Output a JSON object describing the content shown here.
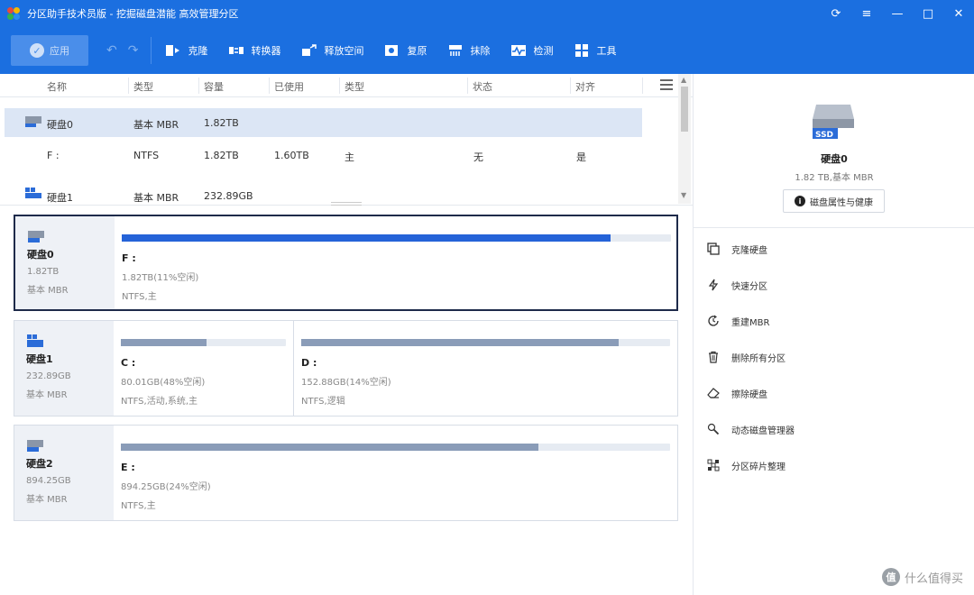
{
  "titlebar": {
    "title": "分区助手技术员版 - 挖掘磁盘潜能 高效管理分区",
    "controls": [
      "⟳",
      "≡",
      "—",
      "□",
      "✕"
    ]
  },
  "toolbar": {
    "apply_label": "应用",
    "tools": [
      {
        "label": "克隆",
        "icon": "clone-icon"
      },
      {
        "label": "转换器",
        "icon": "convert-icon"
      },
      {
        "label": "释放空间",
        "icon": "free-space-icon"
      },
      {
        "label": "复原",
        "icon": "recover-icon"
      },
      {
        "label": "抹除",
        "icon": "wipe-icon"
      },
      {
        "label": "检测",
        "icon": "test-icon"
      },
      {
        "label": "工具",
        "icon": "tools-icon"
      }
    ]
  },
  "table": {
    "headers": [
      "名称",
      "类型",
      "容量",
      "已使用",
      "类型",
      "状态",
      "对齐"
    ],
    "rows": [
      {
        "name": "硬盘0",
        "type": "基本 MBR",
        "capacity": "1.82TB",
        "used": "",
        "fs": "",
        "status": "",
        "align": ""
      },
      {
        "name": "F :",
        "type": "NTFS",
        "capacity": "1.82TB",
        "used": "1.60TB",
        "fs": "主",
        "status": "无",
        "align": "是"
      },
      {
        "name": "硬盘1",
        "type": "基本 MBR",
        "capacity": "232.89GB",
        "used": "",
        "fs": "",
        "status": "",
        "align": ""
      }
    ]
  },
  "disks": [
    {
      "name": "硬盘0",
      "size": "1.82TB",
      "type": "基本 MBR",
      "partitions": [
        {
          "label": "F :",
          "info": "1.82TB(11%空闲)",
          "fs": "NTFS,主",
          "used_fraction": 0.89
        }
      ]
    },
    {
      "name": "硬盘1",
      "size": "232.89GB",
      "type": "基本 MBR",
      "partitions": [
        {
          "label": "C :",
          "info": "80.01GB(48%空闲)",
          "fs": "NTFS,活动,系统,主",
          "used_fraction": 0.52
        },
        {
          "label": "D :",
          "info": "152.88GB(14%空闲)",
          "fs": "NTFS,逻辑",
          "used_fraction": 0.86
        }
      ]
    },
    {
      "name": "硬盘2",
      "size": "894.25GB",
      "type": "基本 MBR",
      "partitions": [
        {
          "label": "E :",
          "info": "894.25GB(24%空闲)",
          "fs": "NTFS,主",
          "used_fraction": 0.76
        }
      ]
    }
  ],
  "right_panel": {
    "badge": "SSD",
    "disk_name": "硬盘0",
    "disk_info": "1.82 TB,基本 MBR",
    "props_label": "磁盘属性与健康",
    "operations": [
      {
        "label": "克隆硬盘",
        "icon": "clone-disk-icon"
      },
      {
        "label": "快速分区",
        "icon": "quick-partition-icon"
      },
      {
        "label": "重建MBR",
        "icon": "rebuild-mbr-icon"
      },
      {
        "label": "删除所有分区",
        "icon": "trash-icon"
      },
      {
        "label": "擦除硬盘",
        "icon": "eraser-icon"
      },
      {
        "label": "动态磁盘管理器",
        "icon": "dynamic-disk-icon"
      },
      {
        "label": "分区碎片整理",
        "icon": "defrag-icon"
      }
    ]
  },
  "watermark": {
    "glyph": "值",
    "text": "什么值得买"
  },
  "colors": {
    "accent": "#1b6fe0",
    "fill_selected": "#2563d8",
    "fill_normal": "#8a9cb8"
  }
}
